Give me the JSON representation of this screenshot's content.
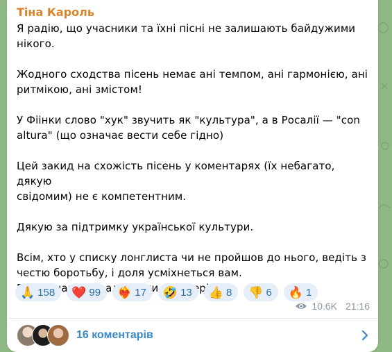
{
  "message": {
    "sender": "Тіна Кароль",
    "text": "Я радію, що учасники та їхні пісні не залишають байдужими\nнікого.\n\nЖодного сходства пісень немає ані темпом, ані гармонією, ані\nритмікою, ані змістом!\n\nУ Фіінки слово \"хук\" звучить як \"культура\", а в Росалії — \"con\naltura\" (що означає вести себе гідно)\n\nЦей закид на схожість пісень у коментарях (їх небагато, дякую\nсвідомим) не є компетентним.\n\nДякую за підтримку української культури.\n\nВсім, хто у списку лонглиста чи не пройшов до нього, ведіть з\nчестю боротьбу, і доля усміхнеться вам.\nP.S. Я знаю хто, але  поки спостерігаю.",
    "views": "10.6K",
    "time": "21:16"
  },
  "reactions": [
    {
      "emoji": "🙏",
      "count": "158",
      "icon": "pray-icon"
    },
    {
      "emoji": "❤️",
      "count": "99",
      "icon": "heart-icon"
    },
    {
      "emoji": "❤️‍🔥",
      "count": "17",
      "icon": "heart-on-fire-icon"
    },
    {
      "emoji": "🤣",
      "count": "13",
      "icon": "rofl-icon"
    },
    {
      "emoji": "👍",
      "count": "8",
      "icon": "thumbs-up-icon"
    },
    {
      "emoji": "👎",
      "count": "6",
      "icon": "thumbs-down-icon"
    },
    {
      "emoji": "🔥",
      "count": "1",
      "icon": "fire-icon"
    }
  ],
  "comments": {
    "label": "16 коментарів"
  },
  "colors": {
    "sender": "#d9832b",
    "reaction_bg": "#e5eef9",
    "reaction_text": "#2d6fa5",
    "link": "#3a87c6",
    "background": "#8fb884"
  }
}
